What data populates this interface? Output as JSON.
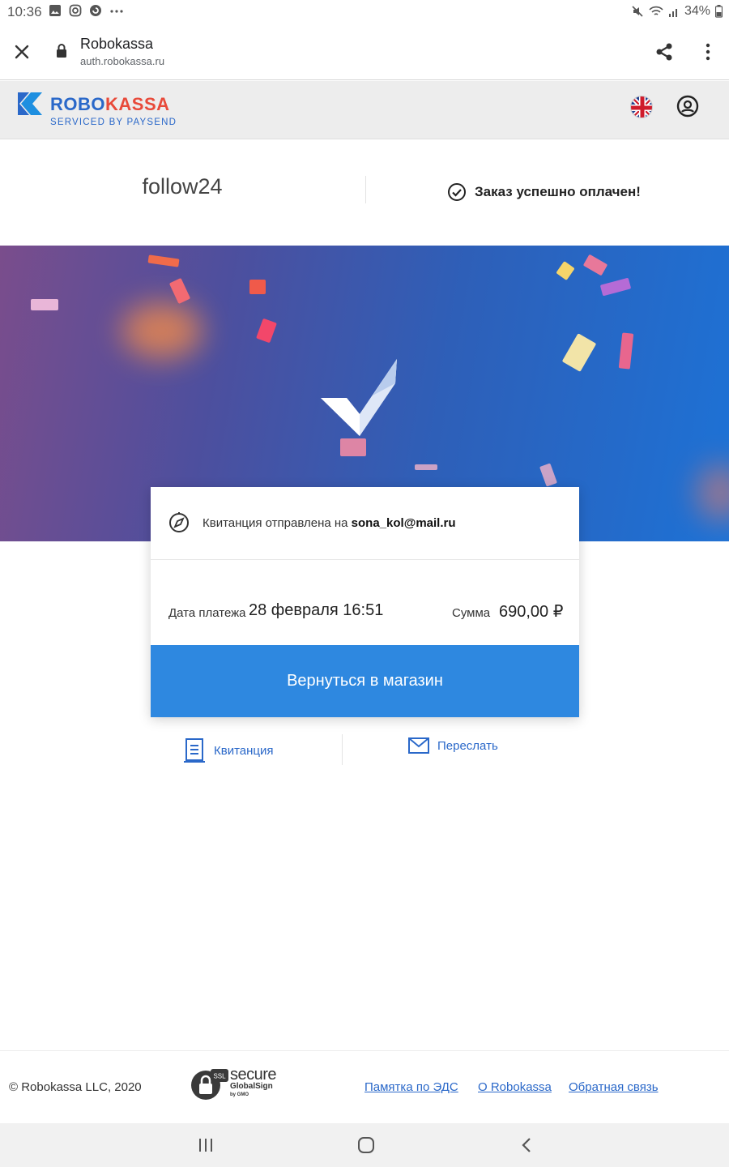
{
  "status_bar": {
    "time": "10:36",
    "battery": "34%"
  },
  "browser": {
    "title": "Robokassa",
    "url": "auth.robokassa.ru"
  },
  "header": {
    "logo_robo": "ROBO",
    "logo_kassa": "KASSA",
    "logo_sub": "SERVICED BY PAYSEND"
  },
  "merchant": {
    "name": "follow24",
    "status": "Заказ успешно оплачен!"
  },
  "card": {
    "receipt_text": "Квитанция отправлена на ",
    "email": "sona_kol@mail.ru",
    "date_label": "Дата платежа",
    "date_value": "28 февраля 16:51",
    "sum_label": "Сумма",
    "sum_value": "690,00 ₽",
    "return_button": "Вернуться в магазин"
  },
  "actions": {
    "receipt": "Квитанция",
    "forward": "Переслать"
  },
  "footer": {
    "copyright": "© Robokassa LLC, 2020",
    "ssl_secure": "secure",
    "ssl_globalsign": "GlobalSign",
    "ssl_gmo": "by GMO",
    "ssl_badge": "SSL",
    "links": [
      "Памятка по ЭДС",
      "О Robokassa",
      "Обратная связь"
    ]
  },
  "colors": {
    "accent": "#2e88e0",
    "brand_blue": "#2a68c9",
    "brand_red": "#e84a3a"
  }
}
